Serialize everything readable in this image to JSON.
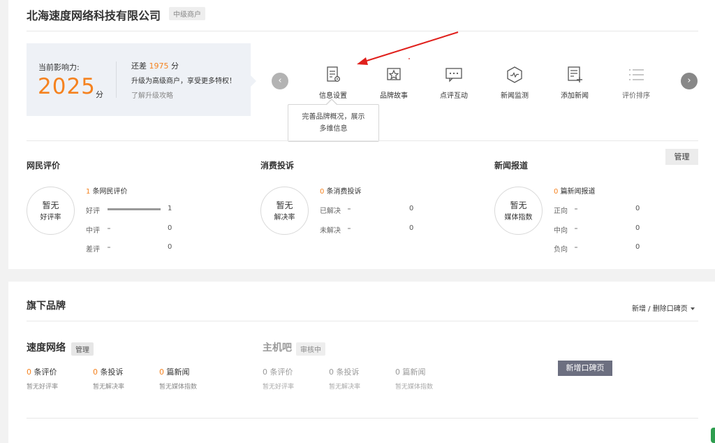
{
  "header": {
    "company_name": "北海速度网络科技有限公司",
    "tier_tag": "中级商户"
  },
  "influence": {
    "label": "当前影响力:",
    "score": "2025",
    "unit": "分",
    "gap_prefix": "还差",
    "gap_value": "1975",
    "gap_unit": "分",
    "upgrade_text": "升级为高级商户，享受更多特权！",
    "upgrade_link": "了解升级攻略"
  },
  "features": [
    {
      "label": "信息设置",
      "icon": "document-settings-icon"
    },
    {
      "label": "品牌故事",
      "icon": "star-frame-icon"
    },
    {
      "label": "点评互动",
      "icon": "chat-bubble-icon"
    },
    {
      "label": "新闻监测",
      "icon": "hexagon-pulse-icon"
    },
    {
      "label": "添加新闻",
      "icon": "add-document-icon"
    },
    {
      "label": "评价排序",
      "icon": "list-order-icon"
    }
  ],
  "nav": {
    "prev_icon": "chevron-left-icon",
    "next_icon": "chevron-right-icon"
  },
  "tooltip": {
    "line1": "完善品牌概况，展示",
    "line2": "多维信息"
  },
  "manage_button": "管理",
  "sections": {
    "reviews": {
      "title": "网民评价",
      "ring_top": "暂无",
      "ring_bottom": "好评率",
      "count": "1",
      "count_label": "条网民评价",
      "rows": [
        {
          "label": "好评",
          "value": "1",
          "fraction": 1.0
        },
        {
          "label": "中评",
          "value": "0",
          "fraction": 0
        },
        {
          "label": "差评",
          "value": "0",
          "fraction": 0
        }
      ]
    },
    "complaints": {
      "title": "消费投诉",
      "ring_top": "暂无",
      "ring_bottom": "解决率",
      "count": "0",
      "count_label": "条消费投诉",
      "rows": [
        {
          "label": "已解决",
          "value": "0",
          "fraction": 0
        },
        {
          "label": "未解决",
          "value": "0",
          "fraction": 0
        }
      ]
    },
    "news": {
      "title": "新闻报道",
      "ring_top": "暂无",
      "ring_bottom": "媒体指数",
      "count": "0",
      "count_label": "篇新闻报道",
      "rows": [
        {
          "label": "正向",
          "value": "0",
          "fraction": 0
        },
        {
          "label": "中向",
          "value": "0",
          "fraction": 0
        },
        {
          "label": "负向",
          "value": "0",
          "fraction": 0
        }
      ]
    }
  },
  "brands": {
    "title": "旗下品牌",
    "add_delete": "新增 / 删除口碑页",
    "new_page_button": "新增口碑页",
    "items": [
      {
        "name": "速度网络",
        "tag": "管理",
        "stats": [
          {
            "count": "0",
            "label": "条评价",
            "sub": "暂无好评率"
          },
          {
            "count": "0",
            "label": "条投诉",
            "sub": "暂无解决率"
          },
          {
            "count": "0",
            "label": "篇新闻",
            "sub": "暂无媒体指数"
          }
        ]
      },
      {
        "name": "主机吧",
        "tag": "审核中",
        "stats": [
          {
            "count": "0",
            "label": "条评价",
            "sub": "暂无好评率"
          },
          {
            "count": "0",
            "label": "条投诉",
            "sub": "暂无解决率"
          },
          {
            "count": "0",
            "label": "篇新闻",
            "sub": "暂无媒体指数"
          }
        ]
      }
    ]
  },
  "colors": {
    "accent": "#f5821f",
    "annotation_arrow": "#e0201c",
    "button_dark": "#6c6f80"
  }
}
